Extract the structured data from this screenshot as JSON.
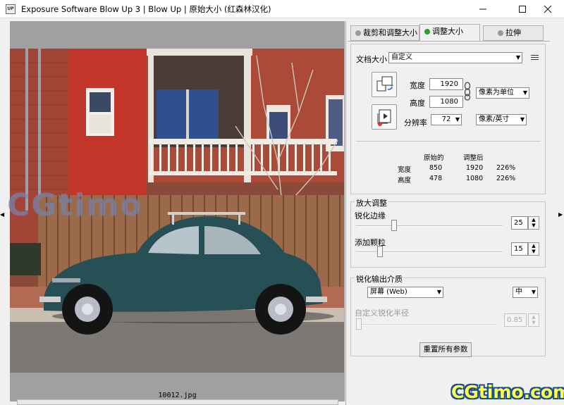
{
  "window": {
    "title": "Exposure Software Blow Up 3 | Blow Up | 原始大小   (红森林汉化)",
    "app_icon_text": "UP",
    "minimize_icon": "minimize-icon",
    "maximize_icon": "maximize-icon",
    "close_icon": "close-icon"
  },
  "canvas": {
    "filename": "10012.jpg",
    "background_color": "#a0a0a0"
  },
  "tabs": [
    {
      "label": "裁剪和调整大小",
      "active": false
    },
    {
      "label": "调整大小",
      "active": true
    },
    {
      "label": "拉伸",
      "active": false
    }
  ],
  "resize": {
    "doc_size_label": "文档大小",
    "doc_size_value": "自定义",
    "width_label": "宽度",
    "width_value": "1920",
    "height_label": "高度",
    "height_value": "1080",
    "unit_value": "像素为单位",
    "resolution_label": "分辨率",
    "resolution_value": "72",
    "resolution_unit": "像素/英寸",
    "rotate_icon": "rotate-orientation-icon",
    "reset_icon": "reset-crop-icon",
    "link_icon": "chain-link-icon",
    "menu_icon": "menu-icon"
  },
  "summary": {
    "headers": [
      "原始的",
      "调整后"
    ],
    "rows": [
      {
        "label": "宽度",
        "original": "850",
        "adjusted": "1920",
        "percent": "226%"
      },
      {
        "label": "高度",
        "original": "478",
        "adjusted": "1080",
        "percent": "226%"
      }
    ]
  },
  "enlarge": {
    "group_label": "放大调整",
    "sharpen_label": "锐化边缘",
    "sharpen_value": "25",
    "sharpen_level": 0.25,
    "grain_label": "添加颗粒",
    "grain_value": "15",
    "grain_level": 0.15
  },
  "output": {
    "group_label": "锐化输出介质",
    "medium_value": "屏幕 (Web)",
    "strength_value": "中",
    "custom_radius_label": "自定义锐化半径",
    "custom_radius_value": "0.85",
    "custom_radius_level": 0.0,
    "reset_all_label": "重置所有参数"
  },
  "watermarks": {
    "overlay_text": "CGtimo",
    "corner_text": "CGtimo.com"
  }
}
